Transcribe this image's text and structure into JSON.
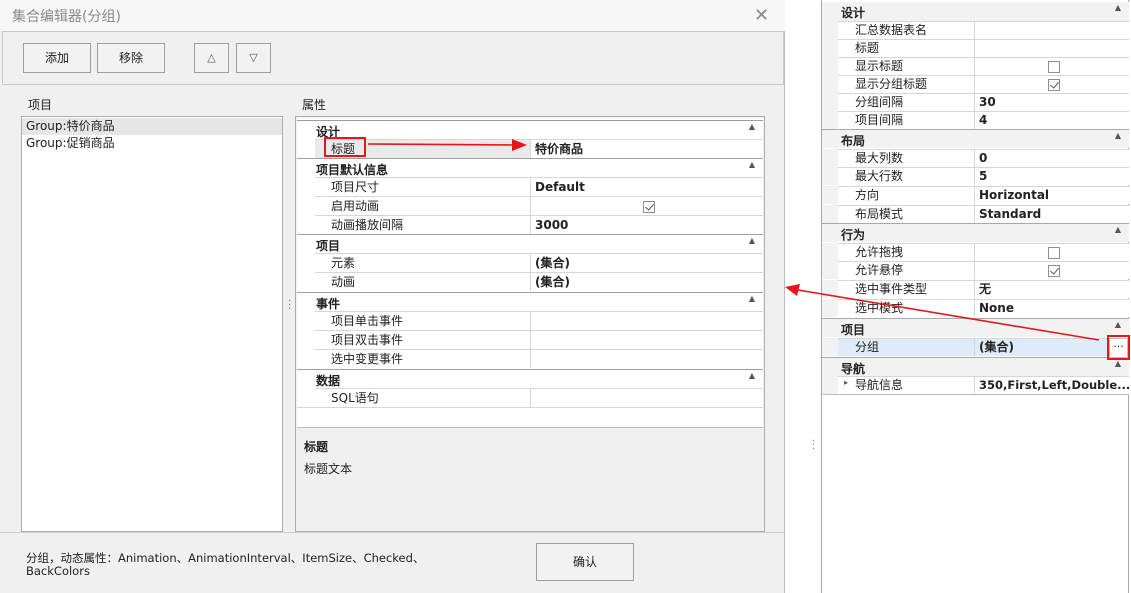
{
  "dialog": {
    "title": "集合编辑器(分组)",
    "close_glyph": "✕",
    "toolbar": {
      "add": "添加",
      "remove": "移除",
      "up": "△",
      "down": "▽"
    },
    "items_label": "项目",
    "properties_label": "属性",
    "items": [
      "Group:特价商品",
      "Group:促销商品"
    ],
    "grid": {
      "design": {
        "title": "设计",
        "rows": [
          {
            "name": "标题",
            "value": "特价商品"
          }
        ]
      },
      "defaults": {
        "title": "项目默认信息",
        "rows": [
          {
            "name": "项目尺寸",
            "value": "Default"
          },
          {
            "name": "启用动画",
            "value": ""
          },
          {
            "name": "动画播放间隔",
            "value": "3000"
          }
        ]
      },
      "item": {
        "title": "项目",
        "rows": [
          {
            "name": "元素",
            "value": "(集合)"
          },
          {
            "name": "动画",
            "value": "(集合)"
          }
        ]
      },
      "events": {
        "title": "事件",
        "rows": [
          {
            "name": "项目单击事件",
            "value": ""
          },
          {
            "name": "项目双击事件",
            "value": ""
          },
          {
            "name": "选中变更事件",
            "value": ""
          }
        ]
      },
      "data": {
        "title": "数据",
        "rows": [
          {
            "name": "SQL语句",
            "value": ""
          }
        ]
      }
    },
    "description": {
      "title": "标题",
      "text": "标题文本"
    },
    "footer": {
      "line1": "分组，动态属性：Animation、AnimationInterval、ItemSize、Checked、",
      "line2": "BackColors",
      "ok": "确认"
    }
  },
  "right_panel": {
    "design": {
      "title": "设计",
      "rows": [
        {
          "name": "汇总数据表名",
          "value": ""
        },
        {
          "name": "标题",
          "value": ""
        },
        {
          "name": "显示标题",
          "value": ""
        },
        {
          "name": "显示分组标题",
          "value": ""
        },
        {
          "name": "分组间隔",
          "value": "30"
        },
        {
          "name": "项目间隔",
          "value": "4"
        }
      ]
    },
    "layout": {
      "title": "布局",
      "rows": [
        {
          "name": "最大列数",
          "value": "0"
        },
        {
          "name": "最大行数",
          "value": "5"
        },
        {
          "name": "方向",
          "value": "Horizontal"
        },
        {
          "name": "布局模式",
          "value": "Standard"
        }
      ]
    },
    "behavior": {
      "title": "行为",
      "rows": [
        {
          "name": "允许拖拽",
          "value": ""
        },
        {
          "name": "允许悬停",
          "value": ""
        },
        {
          "name": "选中事件类型",
          "value": "无"
        },
        {
          "name": "选中模式",
          "value": "None"
        }
      ]
    },
    "item": {
      "title": "项目",
      "rows": [
        {
          "name": "分组",
          "value": "(集合)",
          "ellipsis": "···"
        }
      ]
    },
    "nav": {
      "title": "导航",
      "rows": [
        {
          "name": "导航信息",
          "value": "350,First,Left,Double..."
        }
      ]
    }
  },
  "checkbox_states": {
    "dialog_enable_animation": true,
    "right_show_title": false,
    "right_show_group_title": true,
    "right_allow_drag": false,
    "right_allow_hover": true
  },
  "colors": {
    "annotation_red": "#e8161b",
    "selection_blue": "#ddecf8"
  }
}
